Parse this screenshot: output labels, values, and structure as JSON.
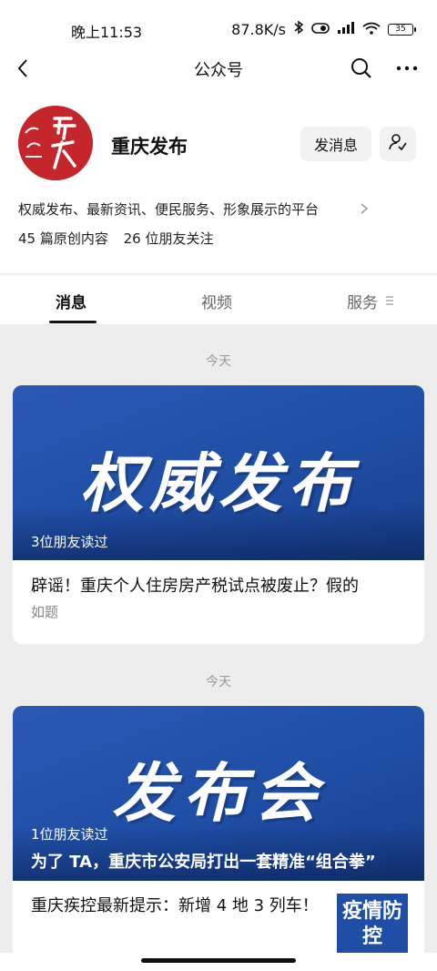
{
  "status_bar": {
    "time": "晚上11:53",
    "network_speed": "87.8K/s",
    "battery": "35"
  },
  "nav": {
    "title": "公众号"
  },
  "profile": {
    "name": "重庆发布",
    "description": "权威发布、最新资讯、便民服务、形象展示的平台",
    "original_count": "45 篇原创内容",
    "friends_follow": "26 位朋友关注",
    "send_message_label": "发消息"
  },
  "tabs": [
    {
      "label": "消息",
      "active": true
    },
    {
      "label": "视频",
      "active": false
    },
    {
      "label": "服务",
      "active": false
    }
  ],
  "feed": [
    {
      "date": "今天",
      "cover_text": "权威发布",
      "read_by": "3位朋友读过",
      "title": "辟谣！重庆个人住房房产税试点被废止？假的",
      "summary": "如题"
    },
    {
      "date": "今天",
      "cover_text": "发布会",
      "read_by": "1位朋友读过",
      "headline": "为了 TA，重庆市公安局打出一套精准“组合拳”",
      "items": [
        {
          "title": "重庆疾控最新提示：新增 4 地 3 列车！",
          "thumb_text": "疫情防控"
        }
      ]
    }
  ],
  "colors": {
    "brand_red": "#c5262b",
    "cover_blue": "#1f4ea6"
  }
}
